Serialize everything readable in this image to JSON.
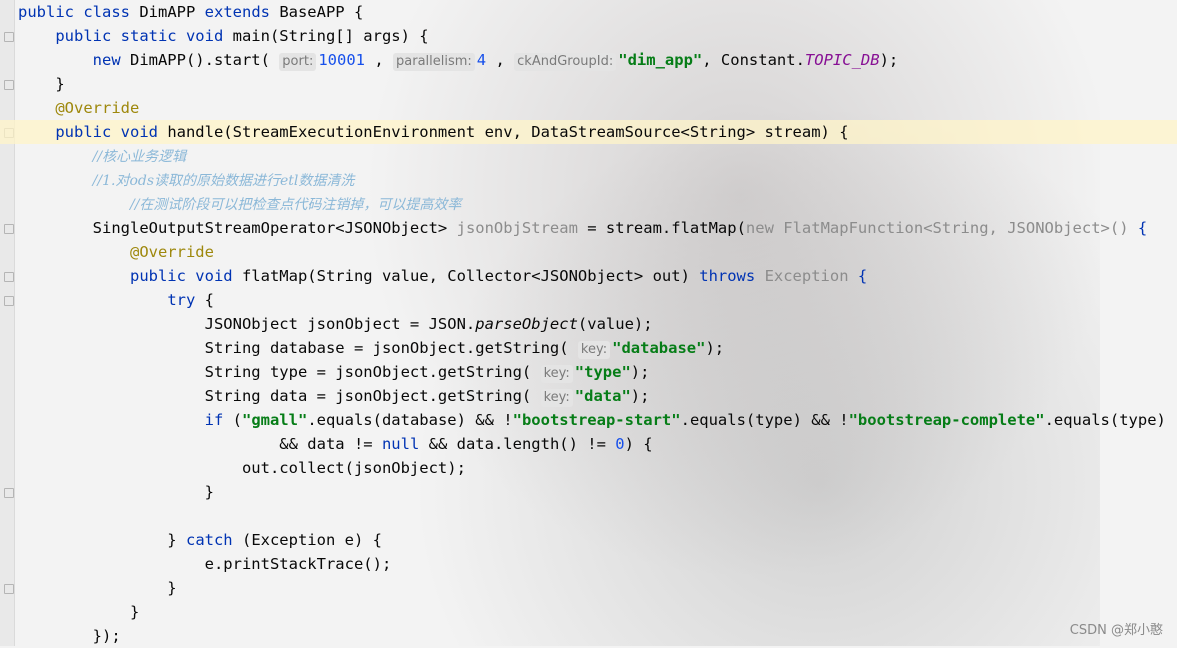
{
  "editor": {
    "lines": [
      {
        "id": 1,
        "parts": [
          [
            "kw",
            "public class "
          ],
          [
            "",
            "DimAPP "
          ],
          [
            "kw",
            "extends "
          ],
          [
            "",
            "BaseAPP {"
          ]
        ]
      },
      {
        "id": 2,
        "parts": [
          [
            "",
            "    "
          ],
          [
            "kw",
            "public static void "
          ],
          [
            "",
            "main(String[] args) {"
          ]
        ]
      },
      {
        "id": 3,
        "parts": [
          [
            "",
            "        "
          ],
          [
            "kw",
            "new "
          ],
          [
            "",
            "DimAPP().start( "
          ],
          [
            "hint",
            "port:"
          ],
          [
            "num",
            "10001"
          ],
          [
            "",
            " , "
          ],
          [
            "hint",
            "parallelism:"
          ],
          [
            "num",
            "4"
          ],
          [
            "",
            " , "
          ],
          [
            "hint",
            "ckAndGroupId:"
          ],
          [
            "str",
            "\"dim_app\""
          ],
          [
            "",
            ", Constant."
          ],
          [
            "const",
            "TOPIC_DB"
          ],
          [
            "",
            ");"
          ]
        ]
      },
      {
        "id": 4,
        "parts": [
          [
            "",
            "    }"
          ]
        ]
      },
      {
        "id": 5,
        "parts": [
          [
            "",
            "    "
          ],
          [
            "ann",
            "@Override"
          ]
        ]
      },
      {
        "id": 6,
        "parts": [
          [
            "",
            "    "
          ],
          [
            "kw",
            "public void "
          ],
          [
            "",
            "handle(StreamExecutionEnvironment env, DataStreamSource<String> stream) {"
          ]
        ]
      },
      {
        "id": 7,
        "parts": [
          [
            "",
            "        "
          ],
          [
            "cmt-cn",
            "//核心业务逻辑"
          ]
        ]
      },
      {
        "id": 8,
        "parts": [
          [
            "",
            "        "
          ],
          [
            "cmt-cn",
            "//1.对ods读取的原始数据进行etl数据清洗"
          ]
        ]
      },
      {
        "id": 9,
        "parts": [
          [
            "",
            "            "
          ],
          [
            "cmt-cn",
            "//在测试阶段可以把检查点代码注销掉，可以提高效率"
          ]
        ]
      },
      {
        "id": 10,
        "parts": [
          [
            "",
            "        SingleOutputStreamOperator<JSONObject> "
          ],
          [
            "gray",
            "jsonObjStream"
          ],
          [
            "",
            " = stream.flatMap("
          ],
          [
            "gray",
            "new FlatMapFunction<String, JSONObject>() "
          ],
          [
            "kw",
            "{"
          ]
        ]
      },
      {
        "id": 11,
        "parts": [
          [
            "",
            "            "
          ],
          [
            "ann",
            "@Override"
          ]
        ]
      },
      {
        "id": 12,
        "parts": [
          [
            "",
            "            "
          ],
          [
            "kw",
            "public void "
          ],
          [
            "",
            "flatMap(String value, Collector<JSONObject> out) "
          ],
          [
            "kw",
            "throws "
          ],
          [
            "gray",
            "Exception "
          ],
          [
            "kw",
            "{"
          ]
        ]
      },
      {
        "id": 13,
        "parts": [
          [
            "",
            "                "
          ],
          [
            "kw",
            "try "
          ],
          [
            "",
            "{"
          ]
        ]
      },
      {
        "id": 14,
        "parts": [
          [
            "",
            "                    JSONObject jsonObject = JSON."
          ],
          [
            "ital",
            "parseObject"
          ],
          [
            "",
            "(value);"
          ]
        ]
      },
      {
        "id": 15,
        "parts": [
          [
            "",
            "                    String database = jsonObject.getString( "
          ],
          [
            "hint",
            "key:"
          ],
          [
            "str",
            "\"database\""
          ],
          [
            "",
            ");"
          ]
        ]
      },
      {
        "id": 16,
        "parts": [
          [
            "",
            "                    String type = jsonObject.getString( "
          ],
          [
            "hint",
            "key:"
          ],
          [
            "str",
            "\"type\""
          ],
          [
            "",
            ");"
          ]
        ]
      },
      {
        "id": 17,
        "parts": [
          [
            "",
            "                    String data = jsonObject.getString( "
          ],
          [
            "hint",
            "key:"
          ],
          [
            "str",
            "\"data\""
          ],
          [
            "",
            ");"
          ]
        ]
      },
      {
        "id": 18,
        "parts": [
          [
            "",
            "                    "
          ],
          [
            "kw",
            "if "
          ],
          [
            "",
            "("
          ],
          [
            "str",
            "\"gmall\""
          ],
          [
            "",
            ".equals(database) && !"
          ],
          [
            "str",
            "\"bootstreap-start\""
          ],
          [
            "",
            ".equals(type) && !"
          ],
          [
            "str",
            "\"bootstreap-complete\""
          ],
          [
            "",
            ".equals(type)"
          ]
        ]
      },
      {
        "id": 19,
        "parts": [
          [
            "",
            "                            && data != "
          ],
          [
            "kw",
            "null "
          ],
          [
            "",
            "&& data.length() != "
          ],
          [
            "num",
            "0"
          ],
          [
            "",
            ") {"
          ]
        ]
      },
      {
        "id": 20,
        "parts": [
          [
            "",
            "                        out.collect(jsonObject);"
          ]
        ]
      },
      {
        "id": 21,
        "parts": [
          [
            "",
            "                    }"
          ]
        ]
      },
      {
        "id": 22,
        "parts": [
          [
            "",
            ""
          ]
        ]
      },
      {
        "id": 23,
        "parts": [
          [
            "",
            "                } "
          ],
          [
            "kw",
            "catch "
          ],
          [
            "",
            "(Exception e) {"
          ]
        ]
      },
      {
        "id": 24,
        "parts": [
          [
            "",
            "                    e.printStackTrace();"
          ]
        ]
      },
      {
        "id": 25,
        "parts": [
          [
            "",
            "                }"
          ]
        ]
      },
      {
        "id": 26,
        "parts": [
          [
            "",
            "            }"
          ]
        ]
      },
      {
        "id": 27,
        "parts": [
          [
            "",
            "        });"
          ]
        ]
      }
    ],
    "highlighted_line": 6
  },
  "watermark": "CSDN @郑小憨"
}
